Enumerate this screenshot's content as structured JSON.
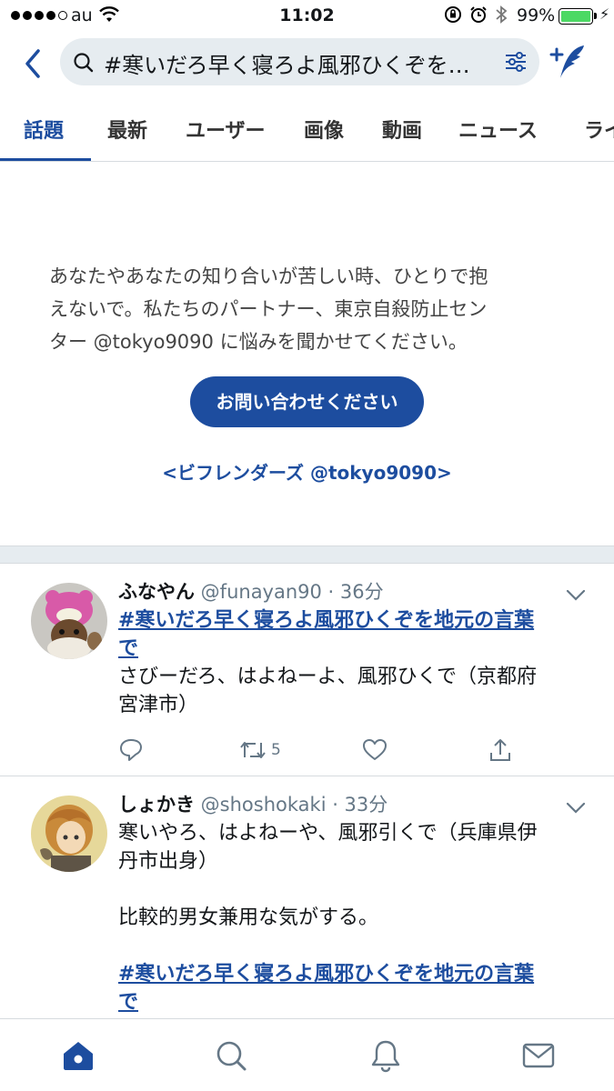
{
  "status_bar": {
    "carrier": "au",
    "time": "11:02",
    "battery_percent": "99%",
    "battery_level": 0.99
  },
  "header": {
    "search_query": "#寒いだろ早く寝ろよ風邪ひくぞを…"
  },
  "tabs": [
    {
      "label": "話題",
      "active": true
    },
    {
      "label": "最新"
    },
    {
      "label": "ユーザー"
    },
    {
      "label": "画像"
    },
    {
      "label": "動画"
    },
    {
      "label": "ニュース"
    },
    {
      "label": "ライ"
    }
  ],
  "help": {
    "message_lines": [
      "あなたやあなたの知り合いが苦しい時、ひとりで抱",
      "えないで。私たちのパートナー、東京自殺防止セン",
      "ター @tokyo9090 に悩みを聞かせてください。"
    ],
    "contact_button": "お問い合わせください",
    "partner": "<ビフレンダーズ @tokyo9090>"
  },
  "tweets": [
    {
      "name": "ふなやん",
      "meta": " @funayan90 · 36分",
      "hashtag_lines": [
        "#寒いだろ早く寝ろよ風邪ひくぞを地元の言葉",
        "で"
      ],
      "text_lines": [
        "さびーだろ、はよねーよ、風邪ひくで（京都府",
        "宮津市）"
      ],
      "retweets": "5"
    },
    {
      "name": "しょかき",
      "meta": " @shoshokaki · 33分",
      "text_lines": [
        "寒いやろ、はよねーや、風邪引くで（兵庫県伊",
        "丹市出身）"
      ],
      "text2": "比較的男女兼用な気がする。",
      "hashtag_lines": [
        "#寒いだろ早く寝ろよ風邪ひくぞを地元の言葉",
        "で"
      ]
    }
  ],
  "colors": {
    "accent": "#1d4d9f",
    "divider": "#d6dbdf",
    "muted": "#657786",
    "battery": "#4cd964"
  },
  "icons": {
    "back": "chevron-left-icon",
    "search": "search-icon",
    "filter": "filter-sliders-icon",
    "compose": "compose-tweet-icon",
    "reply": "reply-icon",
    "retweet": "retweet-icon",
    "like": "heart-icon",
    "share": "share-icon",
    "home": "home-icon",
    "explore": "search-icon",
    "notifications": "bell-icon",
    "messages": "mail-icon"
  }
}
